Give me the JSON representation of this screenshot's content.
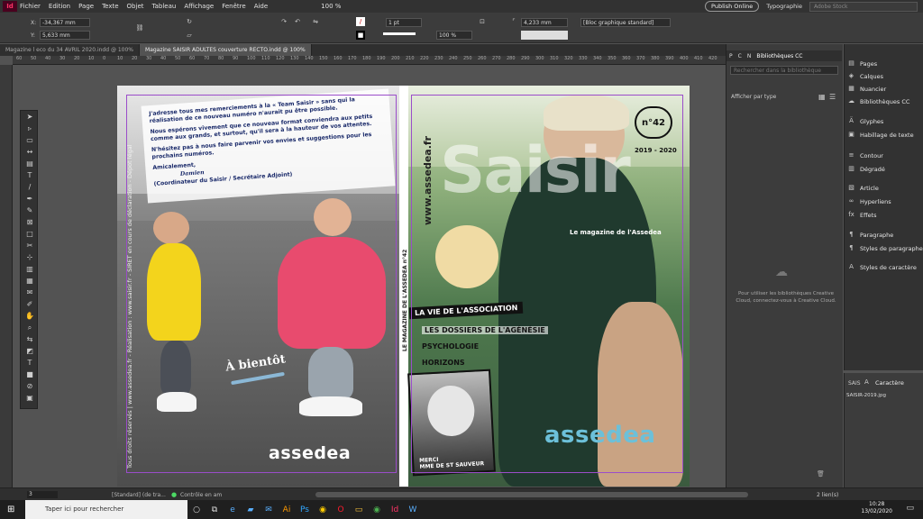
{
  "menubar": {
    "logo": "Id",
    "items": [
      "Fichier",
      "Edition",
      "Page",
      "Texte",
      "Objet",
      "Tableau",
      "Affichage",
      "Fenêtre",
      "Aide"
    ],
    "zoom": "100 %",
    "publish": "Publish Online",
    "workspace": "Typographie",
    "search_placeholder": "Adobe Stock"
  },
  "control": {
    "x_label": "X:",
    "x_value": "-34,367 mm",
    "y_label": "Y:",
    "y_value": "5,633 mm",
    "stroke_weight": "1 pt",
    "opacity": "100 %",
    "width_value": "4,233 mm",
    "style": "[Bloc graphique standard]"
  },
  "tabs": [
    {
      "label": "Magazine l eco du 34 AVRIL 2020.indd @ 100%",
      "active": false
    },
    {
      "label": "Magazine SAISIR ADULTES couverture RECTO.indd @ 100%",
      "active": true
    }
  ],
  "ruler_ticks": [
    "60",
    "50",
    "40",
    "30",
    "20",
    "10",
    "0",
    "10",
    "20",
    "30",
    "40",
    "50",
    "60",
    "70",
    "80",
    "90",
    "100",
    "110",
    "120",
    "130",
    "140",
    "150",
    "160",
    "170",
    "180",
    "190",
    "200",
    "210",
    "220",
    "230",
    "240",
    "250",
    "260",
    "270",
    "280",
    "290",
    "300",
    "310",
    "320",
    "330",
    "340",
    "350",
    "360",
    "370",
    "380",
    "390",
    "400",
    "410",
    "420"
  ],
  "back_cover": {
    "letter_p1": "J'adresse tous mes remerciements à la « Team Saisir » sans qui la réalisation de ce nouveau numéro n'aurait pu être possible.",
    "letter_p2": "Nous espérons vivement que ce nouveau format conviendra aux petits comme aux grands, et surtout, qu'il sera à la hauteur de vos attentes.",
    "letter_p3": "N'hésitez pas à nous faire parvenir vos envies et suggestions pour les prochains numéros.",
    "letter_sign1": "Amicalement,",
    "letter_signature": "Damien",
    "letter_sign2": "(Coordinateur du Saisir / Secrétaire Adjoint)",
    "bientot": "À bientôt",
    "logo": "assedea",
    "vertical": "Tous droits réservés | www.assedea.fr - Réalisation : www.saisir.fr - SIRET en cours de déclaration - Dépot légal"
  },
  "spine": {
    "text": "LE MAGAZINE DE L'ASSEDEA   n°42"
  },
  "front_cover": {
    "title": "Saisir",
    "subtitle": "Le magazine de l'Assedea",
    "url": "www.assedea.fr",
    "issue": "n°42",
    "year": "2019 - 2020",
    "banner": "LA VIE DE L'ASSOCIATION",
    "sections": [
      "LES DOSSIERS DE L'AGÉNÉSIE",
      "PSYCHOLOGIE",
      "HORIZONS"
    ],
    "photo_caption": "MERCI\nMME DE ST SAUVEUR",
    "logo": "assedea"
  },
  "cc_panel": {
    "tabs": [
      "P",
      "C",
      "N",
      "Bibliothèques CC"
    ],
    "search_placeholder": "Rechercher dans la bibliothèque",
    "filter": "Afficher par type",
    "message": "Pour utiliser les bibliothèques Creative Cloud, connectez-vous à Creative Cloud."
  },
  "right_panels": [
    {
      "label": "Pages",
      "icon": "pages-icon",
      "glyph": "▤"
    },
    {
      "label": "Calques",
      "icon": "layers-icon",
      "glyph": "◈"
    },
    {
      "label": "Nuancier",
      "icon": "swatches-icon",
      "glyph": "▦"
    },
    {
      "label": "Bibliothèques CC",
      "icon": "cc-libraries-icon",
      "glyph": "☁"
    },
    {
      "label": "Glyphes",
      "icon": "glyphs-icon",
      "glyph": "Ä"
    },
    {
      "label": "Habillage de texte",
      "icon": "text-wrap-icon",
      "glyph": "▣"
    },
    {
      "label": "Contour",
      "icon": "stroke-icon",
      "glyph": "≡"
    },
    {
      "label": "Dégradé",
      "icon": "gradient-icon",
      "glyph": "▥"
    },
    {
      "label": "Article",
      "icon": "article-icon",
      "glyph": "▧"
    },
    {
      "label": "Hyperliens",
      "icon": "hyperlinks-icon",
      "glyph": "∞"
    },
    {
      "label": "Effets",
      "icon": "effects-icon",
      "glyph": "fx"
    },
    {
      "label": "Paragraphe",
      "icon": "paragraph-icon",
      "glyph": "¶"
    },
    {
      "label": "Styles de paragraphe",
      "icon": "paragraph-styles-icon",
      "glyph": "¶"
    },
    {
      "label": "Styles de caractère",
      "icon": "character-styles-icon",
      "glyph": "A"
    }
  ],
  "char_panel": {
    "tab1": "SAIS",
    "tab2": "Caractère",
    "link": "SAISIR-2019.jpg"
  },
  "statusbar": {
    "page": "3",
    "style": "[Standard] (de tra...",
    "mode": "Contrôle en am",
    "links": "2 lien(s)"
  },
  "taskbar": {
    "search": "Taper ici pour rechercher",
    "time": "10:28",
    "date": "13/02/2020"
  }
}
